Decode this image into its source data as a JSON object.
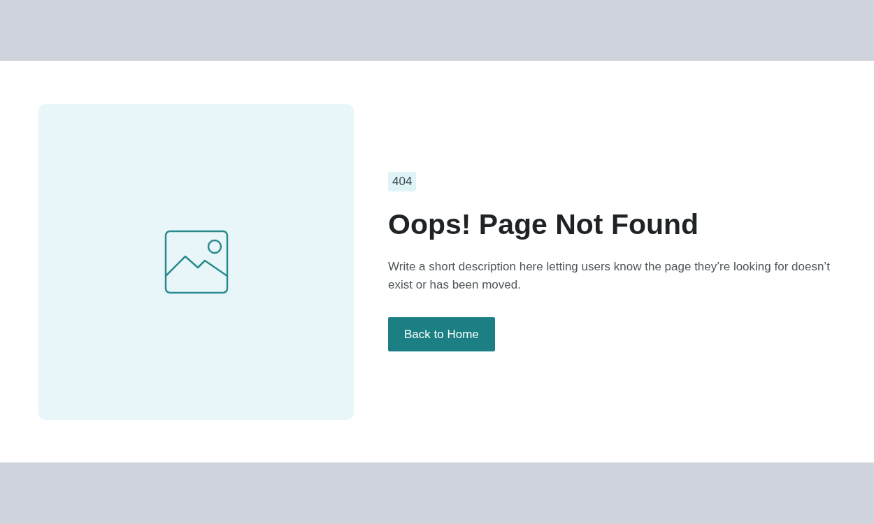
{
  "badge": "404",
  "heading": "Oops! Page Not Found",
  "description": "Write a short description here letting users know the page they’re looking for doesn’t exist or has been moved.",
  "button": "Back to Home"
}
